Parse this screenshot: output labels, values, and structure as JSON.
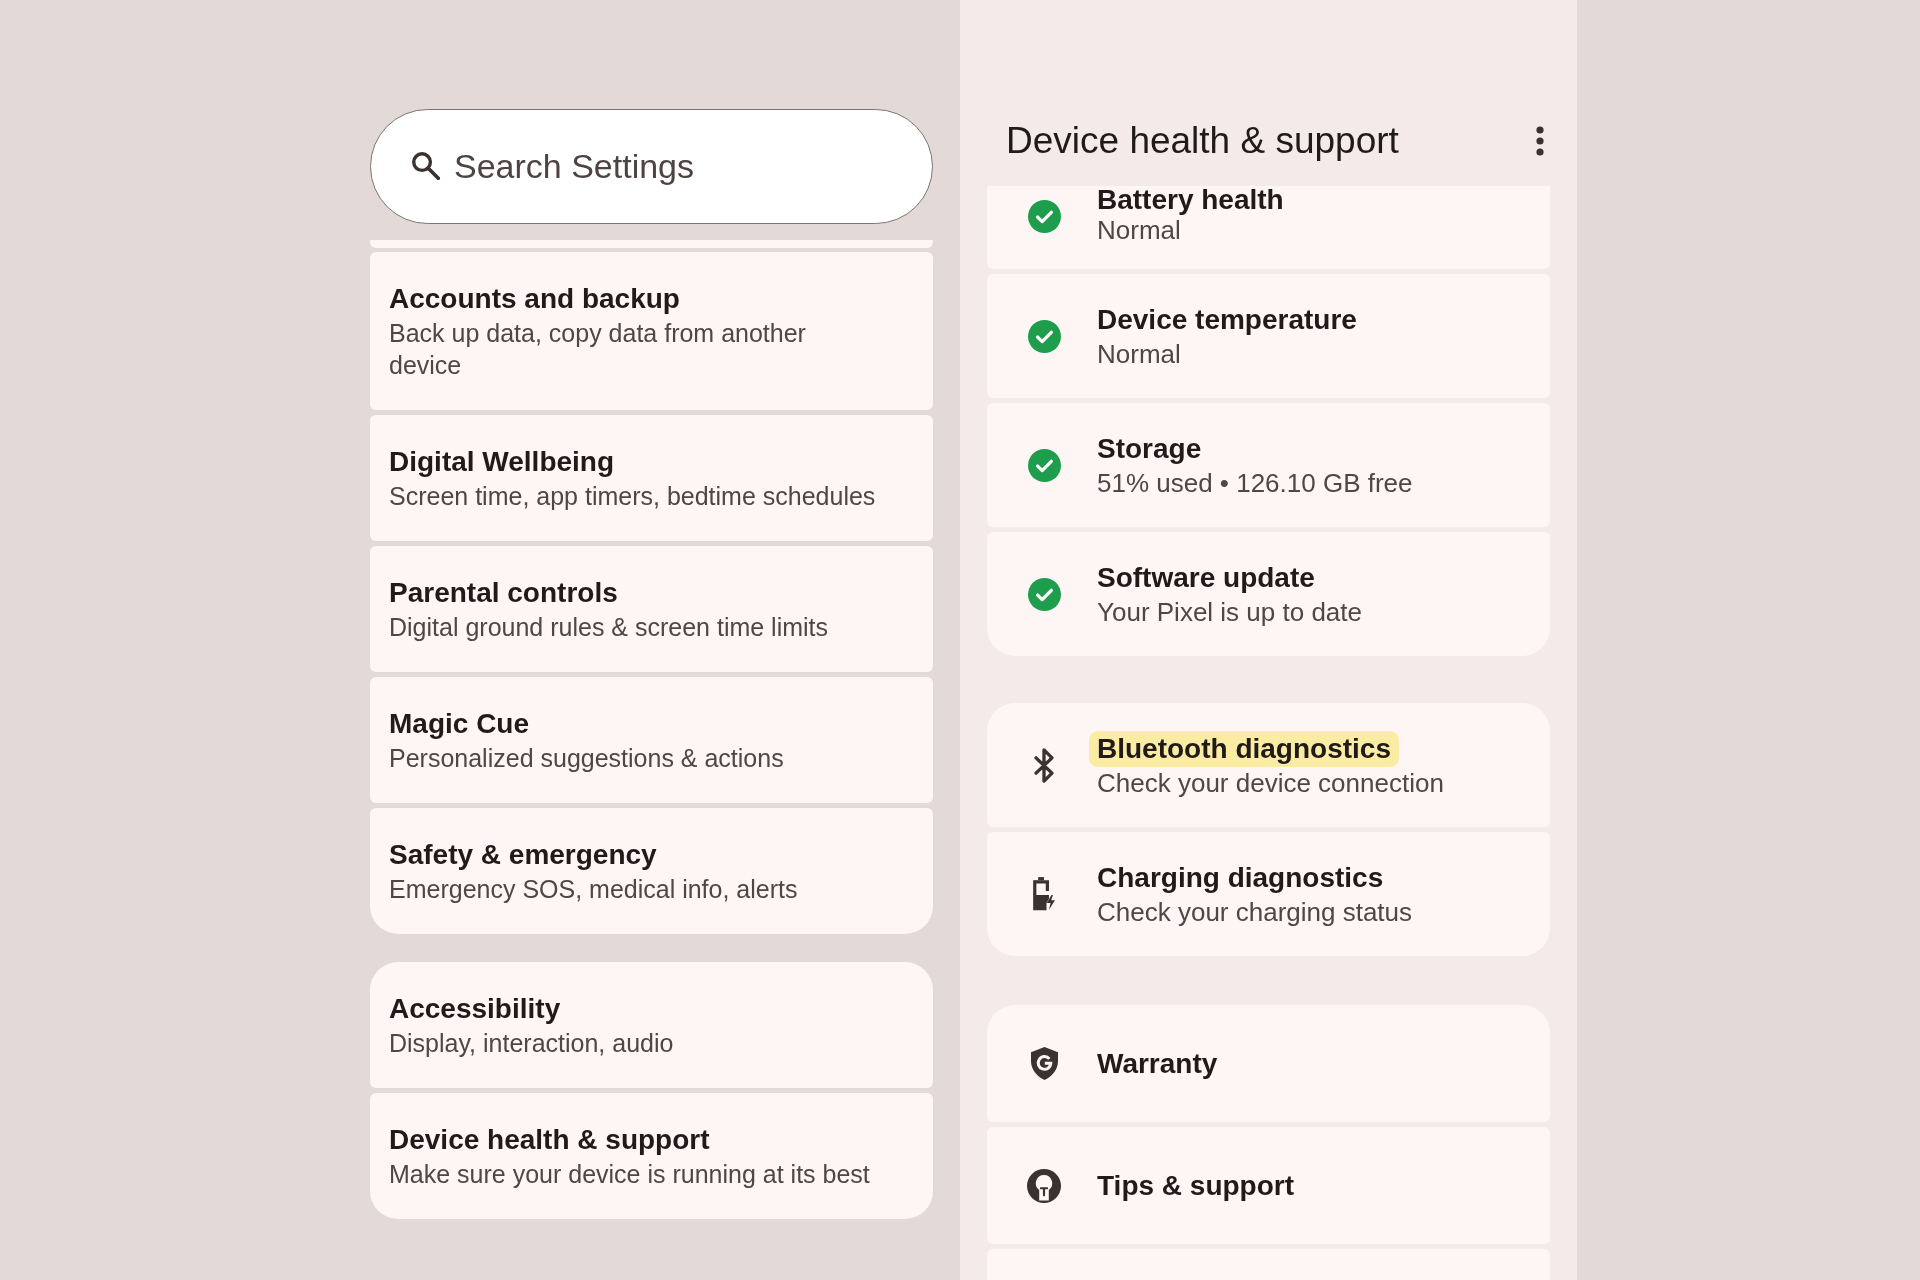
{
  "search": {
    "placeholder": "Search Settings"
  },
  "settings_list": {
    "groups": [
      {
        "items": [
          {
            "title": "Accounts and backup",
            "subtitle": "Back up data, copy data from another device"
          },
          {
            "title": "Digital Wellbeing",
            "subtitle": "Screen time, app timers, bedtime schedules"
          },
          {
            "title": "Parental controls",
            "subtitle": "Digital ground rules & screen time limits"
          },
          {
            "title": "Magic Cue",
            "subtitle": "Personalized suggestions & actions"
          },
          {
            "title": "Safety & emergency",
            "subtitle": "Emergency SOS, medical info, alerts"
          }
        ]
      },
      {
        "items": [
          {
            "title": "Accessibility",
            "subtitle": "Display, interaction, audio"
          },
          {
            "title": "Device health & support",
            "subtitle": "Make sure your device is running at its best"
          }
        ]
      }
    ]
  },
  "device_health": {
    "title": "Device health & support",
    "groups": [
      {
        "items": [
          {
            "kind": "status",
            "ok": true,
            "highlighted": false,
            "title": "Battery health",
            "subtitle": "Normal"
          },
          {
            "kind": "status",
            "ok": true,
            "highlighted": false,
            "title": "Device temperature",
            "subtitle": "Normal"
          },
          {
            "kind": "status",
            "ok": true,
            "highlighted": false,
            "title": "Storage",
            "subtitle": "51% used • 126.10 GB free"
          },
          {
            "kind": "status",
            "ok": true,
            "highlighted": false,
            "title": "Software update",
            "subtitle": "Your Pixel is up to date"
          }
        ]
      },
      {
        "items": [
          {
            "kind": "bluetooth",
            "highlighted": true,
            "title": "Bluetooth diagnostics",
            "subtitle": "Check your device connection"
          },
          {
            "kind": "charging",
            "highlighted": false,
            "title": "Charging diagnostics",
            "subtitle": "Check your charging status"
          }
        ]
      },
      {
        "items": [
          {
            "kind": "warranty",
            "highlighted": false,
            "title": "Warranty"
          },
          {
            "kind": "tips",
            "highlighted": false,
            "title": "Tips & support"
          }
        ]
      }
    ]
  }
}
